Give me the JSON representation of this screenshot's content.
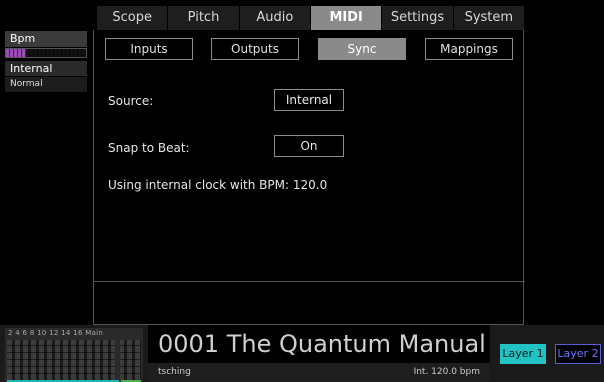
{
  "sidebar": {
    "bpm_label": "Bpm",
    "bpm_meter_fraction": 0.25,
    "clock_source": "Internal 120.0",
    "clock_mode": "Normal"
  },
  "top_tabs": [
    {
      "label": "Scope",
      "active": false
    },
    {
      "label": "Pitch",
      "active": false
    },
    {
      "label": "Audio",
      "active": false
    },
    {
      "label": "MIDI",
      "active": true
    },
    {
      "label": "Settings",
      "active": false
    },
    {
      "label": "System",
      "active": false
    }
  ],
  "sub_tabs": [
    {
      "label": "Inputs",
      "active": false
    },
    {
      "label": "Outputs",
      "active": false
    },
    {
      "label": "Sync",
      "active": true
    },
    {
      "label": "Mappings",
      "active": false
    }
  ],
  "sync": {
    "source_label": "Source:",
    "source_value": "Internal",
    "snap_label": "Snap to Beat:",
    "snap_value": "On",
    "status": "Using internal clock with BPM: 120.0"
  },
  "mixer": {
    "labels": "2  4  6  8  10 12 14 16 Main"
  },
  "patch": {
    "title": "0001 The Quantum Manual",
    "author": "tsching",
    "tempo": "Int. 120.0 bpm"
  },
  "layers": {
    "layer1": "Layer 1",
    "layer2": "Layer 2"
  },
  "colors": {
    "accent_cyan": "#22c3c3",
    "accent_purple": "#9b4fb6",
    "layer2_blue": "#6f74ff",
    "tab_active_gray": "#8a8a8a"
  }
}
